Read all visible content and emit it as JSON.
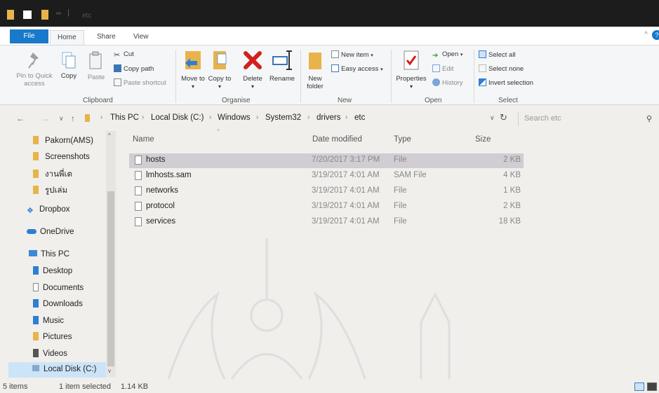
{
  "window": {
    "title": "etc",
    "quick_access": [
      {
        "name": "quick-access-folder-icon",
        "color": "#e8b34a"
      },
      {
        "name": "quick-access-properties-icon",
        "color": "#ffffff"
      },
      {
        "name": "quick-access-new-folder-icon",
        "color": "#e8b34a"
      }
    ]
  },
  "ribbon_tabs": [
    "File",
    "Home",
    "Share",
    "View"
  ],
  "active_tab": "Home",
  "help_label": "?",
  "ribbon": {
    "clipboard": {
      "label": "Clipboard",
      "pin": "Pin to Quick access",
      "copy": "Copy",
      "paste": "Paste",
      "cut": "Cut",
      "copy_path": "Copy path",
      "paste_shortcut": "Paste shortcut"
    },
    "organise": {
      "label": "Organise",
      "move_to": "Move to",
      "copy_to": "Copy to",
      "delete": "Delete",
      "rename": "Rename"
    },
    "new": {
      "label": "New",
      "new_folder": "New folder",
      "new_item": "New item",
      "easy_access": "Easy access"
    },
    "open": {
      "label": "Open",
      "properties": "Properties",
      "open": "Open",
      "edit": "Edit",
      "history": "History"
    },
    "select": {
      "label": "Select",
      "select_all": "Select all",
      "select_none": "Select none",
      "invert": "Invert selection"
    }
  },
  "address": {
    "path": [
      "This PC",
      "Local Disk (C:)",
      "Windows",
      "System32",
      "drivers",
      "etc"
    ],
    "search_placeholder": "Search etc"
  },
  "nav_pane": [
    {
      "label": "Pakorn(AMS)",
      "icon": "folder-icon"
    },
    {
      "label": "Screenshots",
      "icon": "folder-icon"
    },
    {
      "label": "งานพี่เต",
      "icon": "folder-icon"
    },
    {
      "label": "รูปเล่ม",
      "icon": "folder-icon"
    },
    {
      "label": "Dropbox",
      "icon": "dropbox-icon"
    },
    {
      "label": "OneDrive",
      "icon": "onedrive-icon"
    },
    {
      "label": "This PC",
      "icon": "this-pc-icon"
    },
    {
      "label": "Desktop",
      "icon": "desktop-icon"
    },
    {
      "label": "Documents",
      "icon": "documents-icon"
    },
    {
      "label": "Downloads",
      "icon": "downloads-icon"
    },
    {
      "label": "Music",
      "icon": "music-icon"
    },
    {
      "label": "Pictures",
      "icon": "pictures-icon"
    },
    {
      "label": "Videos",
      "icon": "videos-icon"
    },
    {
      "label": "Local Disk (C:)",
      "icon": "local-disk-icon"
    }
  ],
  "columns": {
    "name": "Name",
    "date": "Date modified",
    "type": "Type",
    "size": "Size"
  },
  "files": [
    {
      "name": "hosts",
      "date": "7/20/2017 3:17 PM",
      "type": "File",
      "size": "2 KB",
      "selected": true
    },
    {
      "name": "lmhosts.sam",
      "date": "3/19/2017 4:01 AM",
      "type": "SAM File",
      "size": "4 KB",
      "selected": false
    },
    {
      "name": "networks",
      "date": "3/19/2017 4:01 AM",
      "type": "File",
      "size": "1 KB",
      "selected": false
    },
    {
      "name": "protocol",
      "date": "3/19/2017 4:01 AM",
      "type": "File",
      "size": "2 KB",
      "selected": false
    },
    {
      "name": "services",
      "date": "3/19/2017 4:01 AM",
      "type": "File",
      "size": "18 KB",
      "selected": false
    }
  ],
  "status": {
    "items": "5 items",
    "selected": "1 item selected",
    "size": "1.14 KB"
  },
  "colors": {
    "accent": "#1979ca",
    "selection": "#d2ccd3",
    "folder": "#e8b34a"
  }
}
